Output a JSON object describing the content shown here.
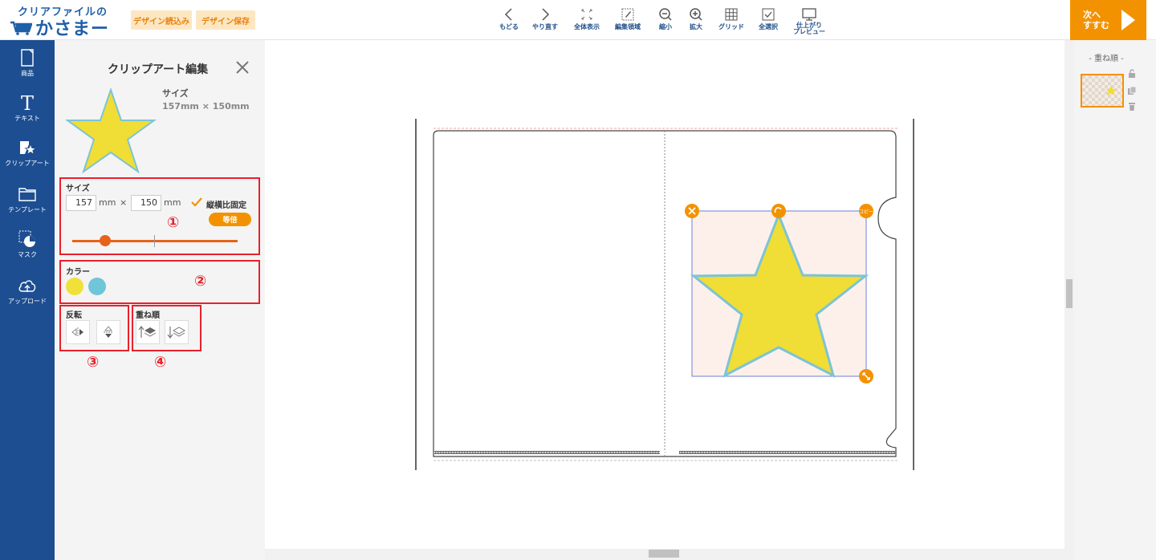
{
  "header": {
    "logo_line1": "クリアファイルの",
    "logo_line2": "かさまーと",
    "design_load": "デザイン読込み",
    "design_save": "デザイン保存",
    "tools": [
      {
        "label": "もどる",
        "icon": "undo-icon"
      },
      {
        "label": "やり直す",
        "icon": "redo-icon"
      },
      {
        "label": "全体表示",
        "icon": "fit-all-icon"
      },
      {
        "label": "編集領域",
        "icon": "edit-area-icon"
      },
      {
        "label": "縮小",
        "icon": "zoom-out-icon"
      },
      {
        "label": "拡大",
        "icon": "zoom-in-icon"
      },
      {
        "label": "グリッド",
        "icon": "grid-icon"
      },
      {
        "label": "全選択",
        "icon": "select-all-icon"
      },
      {
        "label": "仕上がり",
        "label2": "プレビュー",
        "icon": "preview-icon"
      }
    ],
    "next_line1": "次へ",
    "next_line2": "すすむ"
  },
  "leftnav": [
    {
      "label": "商品",
      "icon": "product-icon"
    },
    {
      "label": "テキスト",
      "icon": "text-icon"
    },
    {
      "label": "クリップアート",
      "icon": "clipart-icon"
    },
    {
      "label": "テンプレート",
      "icon": "template-icon"
    },
    {
      "label": "マスク",
      "icon": "mask-icon"
    },
    {
      "label": "アップロード",
      "icon": "upload-icon"
    }
  ],
  "panel": {
    "title": "クリップアート編集",
    "size_label": "サイズ",
    "size_value": "157mm × 150mm",
    "size_section": {
      "label": "サイズ",
      "width": "157",
      "height": "150",
      "unit": "mm",
      "times": "×",
      "keep_ratio": "縦横比固定",
      "equal_button": "等倍",
      "slider_position": 0.2
    },
    "color_section": {
      "label": "カラー",
      "colors": [
        "#f0e03a",
        "#6ec6d8"
      ]
    },
    "flip_section": {
      "label": "反転"
    },
    "order_section": {
      "label": "重ね順"
    },
    "annotations": [
      "①",
      "②",
      "③",
      "④"
    ]
  },
  "canvas": {
    "handle_copy": "コピー",
    "star_fill": "#f0dd35",
    "star_stroke": "#7cc4d4"
  },
  "layers": {
    "title": "- 重ね順 -"
  },
  "colors": {
    "accent": "#f39200",
    "nav_blue": "#1d4e91",
    "annotation_red": "#e8212b"
  }
}
